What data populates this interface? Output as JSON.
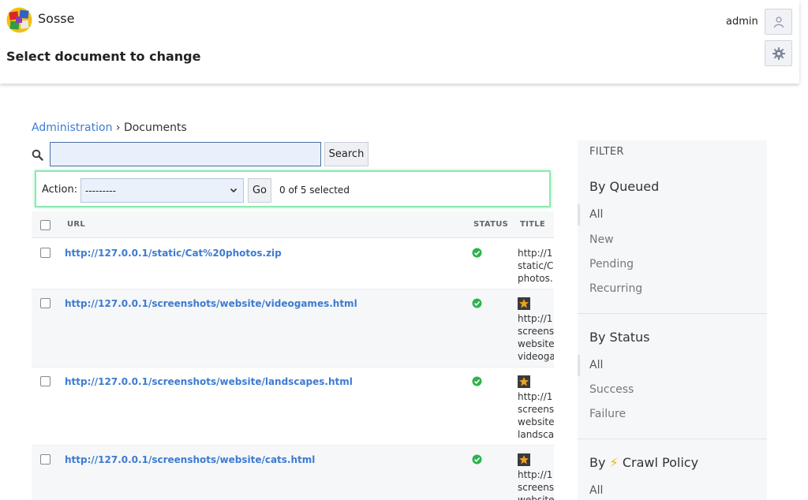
{
  "header": {
    "app_name": "Sosse",
    "page_title": "Select document to change",
    "user": "admin"
  },
  "breadcrumb": {
    "root": "Administration",
    "separator": " › ",
    "current": "Documents"
  },
  "search": {
    "button_label": "Search",
    "value": ""
  },
  "actions": {
    "label": "Action:",
    "selected_option": "---------",
    "go_label": "Go",
    "selected_count": "0 of 5 selected"
  },
  "table": {
    "headers": {
      "url": "URL",
      "status": "STATUS",
      "title": "TITLE"
    },
    "rows": [
      {
        "url": "http://127.0.0.1/static/Cat%20photos.zip",
        "title": "http://127.0.0.1/static/Cat%20photos.zip",
        "title_lines": [
          "http://1",
          "static/C",
          "photos."
        ],
        "favicon": false,
        "status": "success"
      },
      {
        "url": "http://127.0.0.1/screenshots/website/videogames.html",
        "title_lines": [
          "http://1",
          "screens",
          "website",
          "videoga"
        ],
        "favicon": true,
        "status": "success"
      },
      {
        "url": "http://127.0.0.1/screenshots/website/landscapes.html",
        "title_lines": [
          "http://1",
          "screens",
          "website",
          "landsca"
        ],
        "favicon": true,
        "status": "success"
      },
      {
        "url": "http://127.0.0.1/screenshots/website/cats.html",
        "title_lines": [
          "http://1",
          "screens",
          "website"
        ],
        "favicon": true,
        "status": "success"
      }
    ]
  },
  "filter": {
    "title": "FILTER",
    "groups": [
      {
        "title": "By Queued",
        "items": [
          "All",
          "New",
          "Pending",
          "Recurring"
        ]
      },
      {
        "title": "By Status",
        "items": [
          "All",
          "Success",
          "Failure"
        ]
      },
      {
        "title_prefix": "By",
        "title_icon": "lightning-icon",
        "title_rest": "Crawl Policy",
        "items": [
          "All"
        ]
      }
    ]
  },
  "colors": {
    "link": "#3d7bd1",
    "success": "#2bb44a",
    "action_border": "#8ee8b0"
  }
}
